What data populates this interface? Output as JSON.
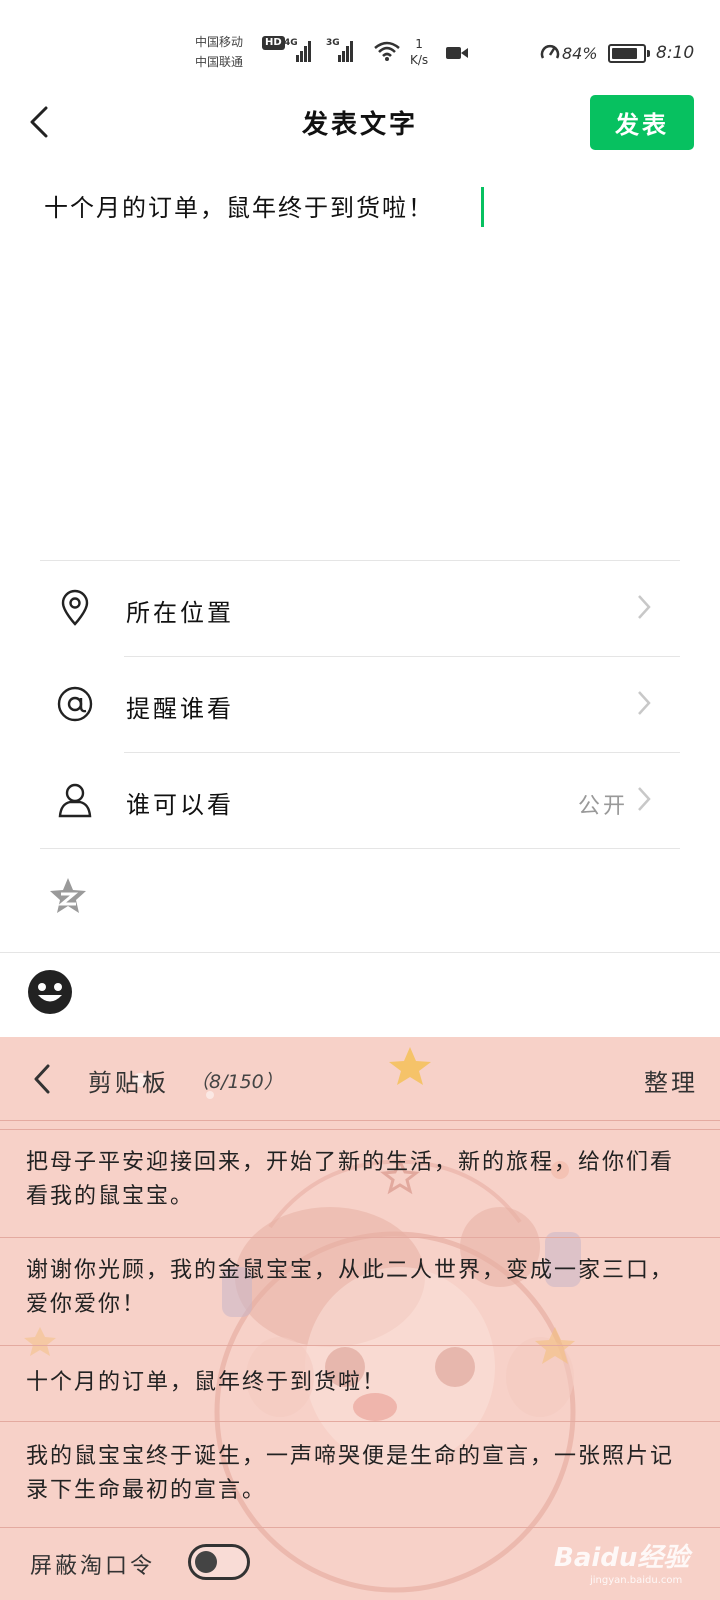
{
  "status_bar": {
    "carrier_1": "中国移动",
    "carrier_2": "中国联通",
    "hd_badge": "HD",
    "signal_1_type": "4G",
    "signal_2_type": "3G",
    "net_speed_value": "1",
    "net_speed_unit": "K/s",
    "battery_percent": "84%",
    "battery_level": 0.84,
    "time": "8:10"
  },
  "header": {
    "title": "发表文字",
    "publish_label": "发表"
  },
  "composer": {
    "text": "十个月的订单，鼠年终于到货啦！"
  },
  "options": [
    {
      "label": "所在位置",
      "value": "",
      "icon": "location-pin-icon"
    },
    {
      "label": "提醒谁看",
      "value": "",
      "icon": "at-sign-icon"
    },
    {
      "label": "谁可以看",
      "value": "公开",
      "icon": "person-icon"
    }
  ],
  "clipboard": {
    "title": "剪贴板",
    "count": "（8/150）",
    "organize_label": "整理",
    "items": [
      "把母子平安迎接回来，开始了新的生活，新的旅程，给你们看看我的鼠宝宝。",
      "谢谢你光顾，我的金鼠宝宝，从此二人世界，变成一家三口，爱你爱你！",
      "十个月的订单，鼠年终于到货啦！",
      "我的鼠宝宝终于诞生，一声啼哭便是生命的宣言，一张照片记录下生命最初的宣言。"
    ],
    "shield_label": "屏蔽淘口令",
    "shield_enabled": false
  },
  "watermark": {
    "brand": "Baidu经验",
    "url": "jingyan.baidu.com"
  },
  "colors": {
    "accent_green": "#07c160",
    "clipboard_bg": "#f7d1c8"
  }
}
